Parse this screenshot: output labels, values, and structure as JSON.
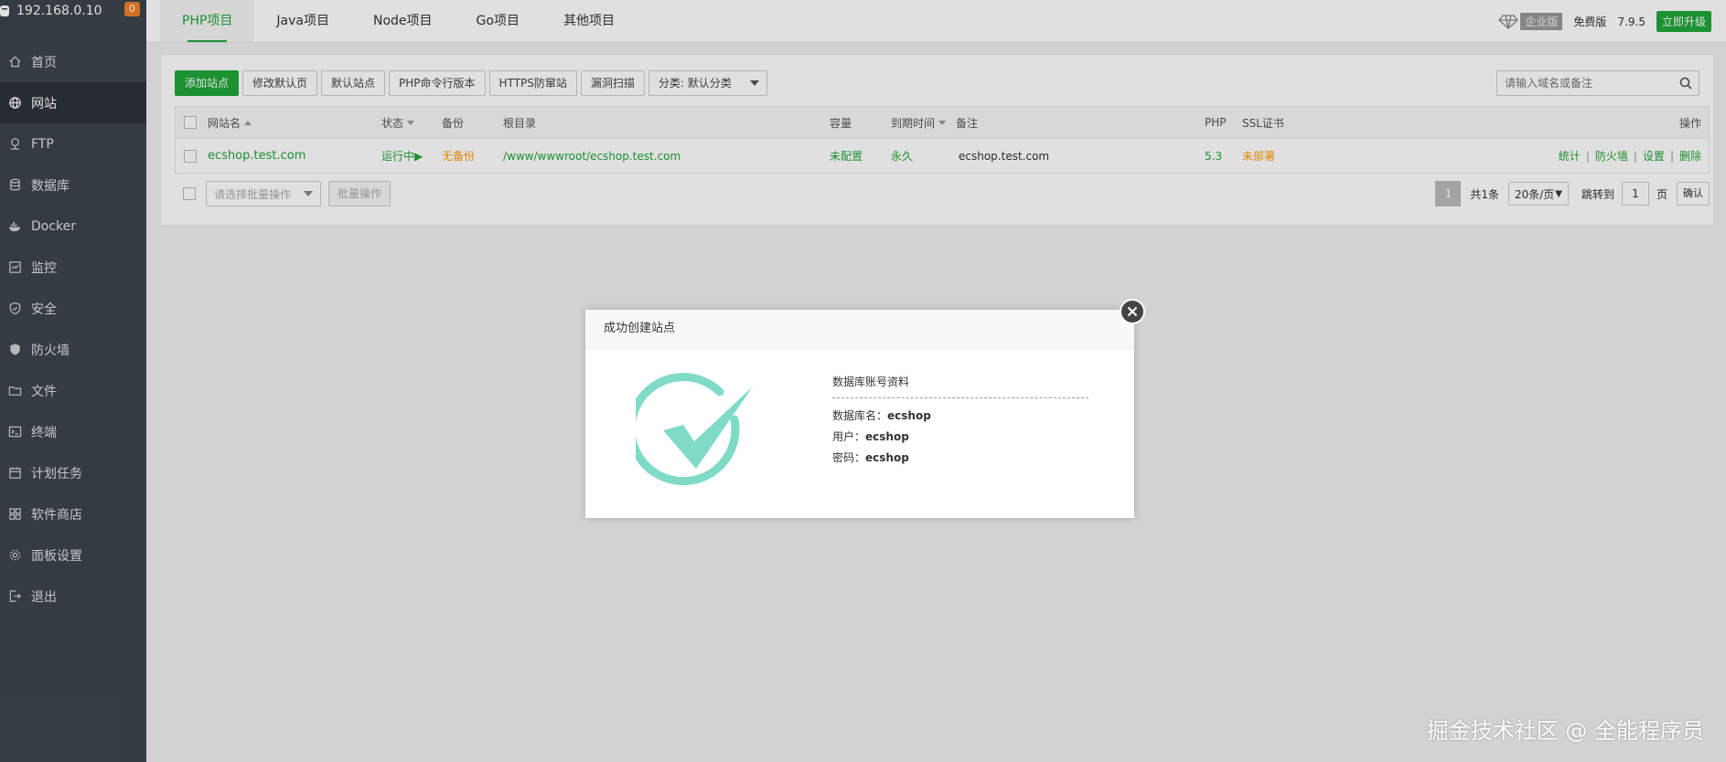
{
  "sidebar": {
    "host": "192.168.0.10",
    "badge": "0",
    "items": [
      {
        "label": "首页",
        "icon": "home-icon"
      },
      {
        "label": "网站",
        "icon": "globe-icon"
      },
      {
        "label": "FTP",
        "icon": "ftp-icon"
      },
      {
        "label": "数据库",
        "icon": "database-icon"
      },
      {
        "label": "Docker",
        "icon": "docker-icon"
      },
      {
        "label": "监控",
        "icon": "monitor-icon"
      },
      {
        "label": "安全",
        "icon": "shield-check-icon"
      },
      {
        "label": "防火墙",
        "icon": "firewall-icon"
      },
      {
        "label": "文件",
        "icon": "folder-icon"
      },
      {
        "label": "终端",
        "icon": "terminal-icon"
      },
      {
        "label": "计划任务",
        "icon": "calendar-icon"
      },
      {
        "label": "软件商店",
        "icon": "grid-icon"
      },
      {
        "label": "面板设置",
        "icon": "gear-icon"
      },
      {
        "label": "退出",
        "icon": "logout-icon"
      }
    ]
  },
  "tabs": [
    "PHP项目",
    "Java项目",
    "Node项目",
    "Go项目",
    "其他项目"
  ],
  "top_right": {
    "enterprise": "企业版",
    "free": "免费版",
    "version": "7.9.5",
    "upgrade": "立即升级"
  },
  "toolbar": {
    "add_site": "添加站点",
    "modify_default": "修改默认页",
    "default_site": "默认站点",
    "php_cli": "PHP命令行版本",
    "https_guard": "HTTPS防窜站",
    "vuln_scan": "漏洞扫描",
    "category": "分类: 默认分类"
  },
  "search": {
    "placeholder": "请输入域名或备注"
  },
  "table": {
    "headers": {
      "name": "网站名",
      "status": "状态",
      "backup": "备份",
      "root": "根目录",
      "capacity": "容量",
      "expire": "到期时间",
      "remark": "备注",
      "php": "PHP",
      "ssl": "SSL证书",
      "ops": "操作"
    },
    "rows": [
      {
        "name": "ecshop.test.com",
        "status": "运行中▶",
        "backup": "无备份",
        "root": "/www/wwwroot/ecshop.test.com",
        "capacity": "未配置",
        "expire": "永久",
        "remark": "ecshop.test.com",
        "php": "5.3",
        "ssl": "未部署",
        "ops": {
          "stats": "统计",
          "firewall": "防火墙",
          "settings": "设置",
          "delete": "删除"
        }
      }
    ]
  },
  "footer": {
    "batch_placeholder": "请选择批量操作",
    "batch_button": "批量操作",
    "current_page": "1",
    "total": "共1条",
    "page_size": "20条/页",
    "jump_to": "跳转到",
    "page_input": "1",
    "page_unit": "页",
    "confirm": "确认"
  },
  "modal": {
    "title": "成功创建站点",
    "db_title": "数据库账号资料",
    "db_name_label": "数据库名：",
    "db_name": "ecshop",
    "user_label": "用户：",
    "user": "ecshop",
    "password_label": "密码：",
    "password": "ecshop"
  },
  "watermark": "掘金技术社区 @ 全能程序员",
  "colors": {
    "accent": "#20a53a",
    "warning": "#ff9900",
    "sidebar_bg": "#3c444d",
    "success_check": "#7fdbc6"
  }
}
